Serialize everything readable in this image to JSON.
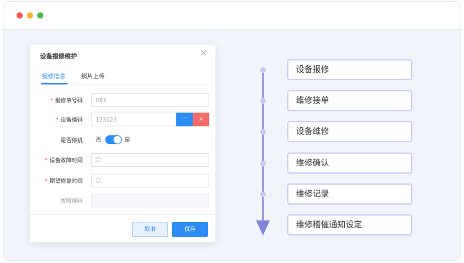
{
  "dialog": {
    "title": "设备报修维护",
    "close_icon": "×",
    "tabs": [
      {
        "label": "报修信息",
        "active": true
      },
      {
        "label": "照片上传",
        "active": false
      }
    ],
    "fields": {
      "repair_no": {
        "label": "报修单号码",
        "required": true,
        "value": "083"
      },
      "device_code": {
        "label": "设备编码",
        "required": true,
        "value": "123123",
        "more_label": "···",
        "delete_label": "×"
      },
      "is_stopped": {
        "label": "是否停机",
        "required": false,
        "off_label": "否",
        "on_label": "是",
        "checked": true
      },
      "fault_time": {
        "label": "设备故障时间",
        "required": true,
        "value": ""
      },
      "expected_time": {
        "label": "期望修复时间",
        "required": true,
        "value": ""
      },
      "fault_code": {
        "label": "故障编码",
        "required": false,
        "value": "",
        "disabled": true
      }
    },
    "required_mark": "*",
    "cancel_label": "取消",
    "save_label": "保存"
  },
  "flow": {
    "steps": [
      "设备报修",
      "维修接单",
      "设备维修",
      "维修确认",
      "维修记录",
      "维修稽催通知设定"
    ]
  },
  "colors": {
    "accent": "#2b8cf4",
    "danger": "#f26b6b",
    "flow": "#7f86d8",
    "step_border": "#cfd2f5"
  }
}
